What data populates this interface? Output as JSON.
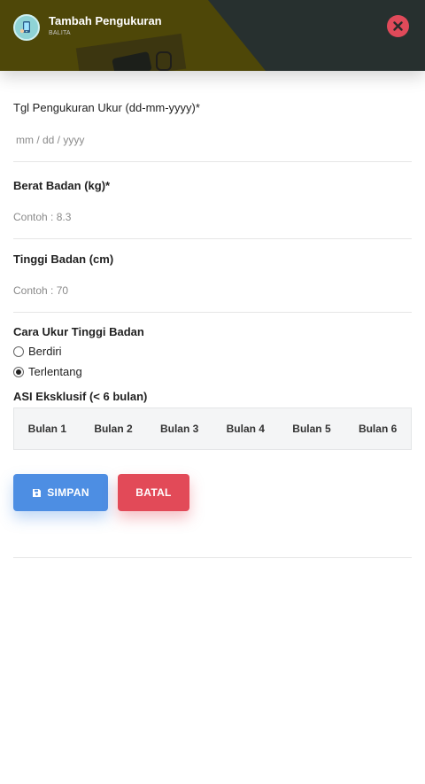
{
  "header": {
    "title": "Tambah Pengukuran",
    "subtitle": "BALITA",
    "accent_close": "#e04a5a"
  },
  "form": {
    "tgl": {
      "label": "Tgl Pengukuran Ukur (dd-mm-yyyy)*",
      "placeholder": "mm / dd / yyyy"
    },
    "berat": {
      "label": "Berat Badan (kg)*",
      "placeholder": "Contoh : 8.3"
    },
    "tinggi": {
      "label": "Tinggi Badan (cm)",
      "placeholder": "Contoh : 70"
    },
    "cara_ukur": {
      "label": "Cara Ukur Tinggi Badan",
      "options": [
        {
          "label": "Berdiri",
          "selected": false
        },
        {
          "label": "Terlentang",
          "selected": true
        }
      ]
    },
    "asi": {
      "label": "ASI Eksklusif (< 6 bulan)",
      "months": [
        "Bulan 1",
        "Bulan 2",
        "Bulan 3",
        "Bulan 4",
        "Bulan 5",
        "Bulan 6"
      ]
    }
  },
  "actions": {
    "save_label": "SIMPAN",
    "cancel_label": "BATAL",
    "save_color": "#4d8ee3",
    "cancel_color": "#e24a58"
  },
  "icons": {
    "avatar": "child-phone-avatar-icon",
    "close": "close-icon",
    "save": "floppy-disk-icon"
  }
}
